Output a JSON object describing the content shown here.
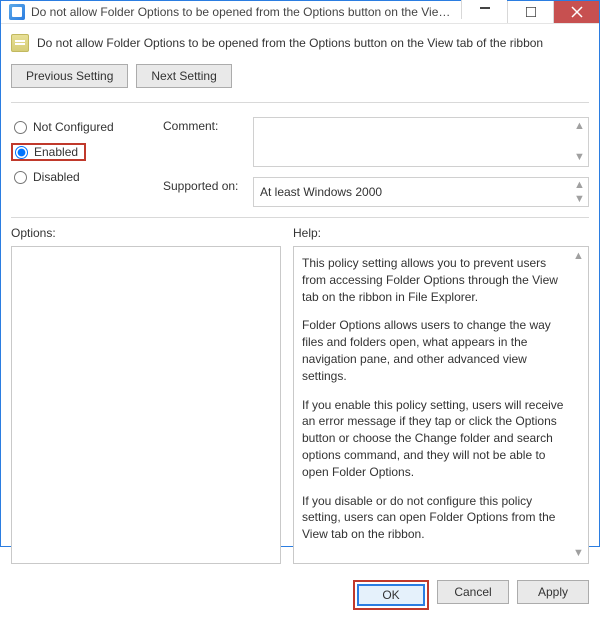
{
  "window": {
    "title": "Do not allow Folder Options to be opened from the Options button on the View tab ..."
  },
  "header": {
    "policy_title": "Do not allow Folder Options to be opened from the Options button on the View tab of the ribbon"
  },
  "nav": {
    "previous": "Previous Setting",
    "next": "Next Setting"
  },
  "state": {
    "not_configured": "Not Configured",
    "enabled": "Enabled",
    "disabled": "Disabled",
    "selected": "enabled"
  },
  "fields": {
    "comment_label": "Comment:",
    "comment_value": "",
    "supported_label": "Supported on:",
    "supported_value": "At least Windows 2000"
  },
  "sections": {
    "options": "Options:",
    "help": "Help:"
  },
  "help": {
    "p1": "This policy setting allows you to prevent users from accessing Folder Options through the View tab on the ribbon in File Explorer.",
    "p2": "Folder Options allows users to change the way files and folders open, what appears in the navigation pane, and other advanced view settings.",
    "p3": "If you enable this policy setting, users will receive an error message if they tap or click the Options button or choose the Change folder and search options command, and they will not be able to open Folder Options.",
    "p4": "If you disable or do not configure this policy setting, users can open Folder Options from the View tab on the ribbon."
  },
  "footer": {
    "ok": "OK",
    "cancel": "Cancel",
    "apply": "Apply"
  }
}
